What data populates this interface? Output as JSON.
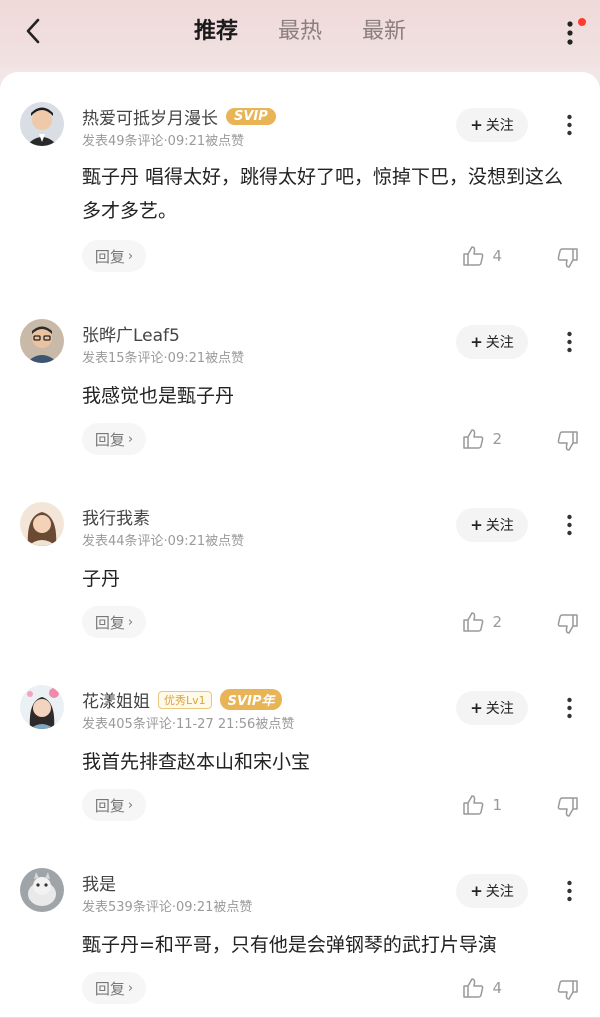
{
  "header": {
    "tabs": [
      {
        "label": "推荐",
        "active": true
      },
      {
        "label": "最热",
        "active": false
      },
      {
        "label": "最新",
        "active": false
      }
    ],
    "has_notification_dot": true
  },
  "comments": [
    {
      "username": "热爱可抵岁月漫长",
      "badges": [
        {
          "text": "SVIP",
          "type": "svip"
        }
      ],
      "meta": "发表49条评论·09:21被点赞",
      "follow_label": "关注",
      "text": "甄子丹 唱得太好，跳得太好了吧，惊掉下巴，没想到这么多才多艺。",
      "reply_label": "回复",
      "likes": "4"
    },
    {
      "username": "张晔广Leaf5",
      "badges": [],
      "meta": "发表15条评论·09:21被点赞",
      "follow_label": "关注",
      "text": "我感觉也是甄子丹",
      "reply_label": "回复",
      "likes": "2"
    },
    {
      "username": "我行我素",
      "badges": [],
      "meta": "发表44条评论·09:21被点赞",
      "follow_label": "关注",
      "text": "子丹",
      "reply_label": "回复",
      "likes": "2"
    },
    {
      "username": "花漾姐姐",
      "badges": [
        {
          "text": "优秀Lv1",
          "type": "lv"
        },
        {
          "text": "SVIP年",
          "type": "svip"
        }
      ],
      "meta": "发表405条评论·11-27 21:56被点赞",
      "follow_label": "关注",
      "text": "我首先排查赵本山和宋小宝",
      "reply_label": "回复",
      "likes": "1"
    },
    {
      "username": "我是",
      "badges": [],
      "meta": "发表539条评论·09:21被点赞",
      "follow_label": "关注",
      "text": "甄子丹=和平哥，只有他是会弹钢琴的武打片导演",
      "reply_label": "回复",
      "likes": "4"
    }
  ],
  "colors": {
    "svip": "#e8b455",
    "dot": "#ff3b30",
    "accent_text": "#222222"
  }
}
